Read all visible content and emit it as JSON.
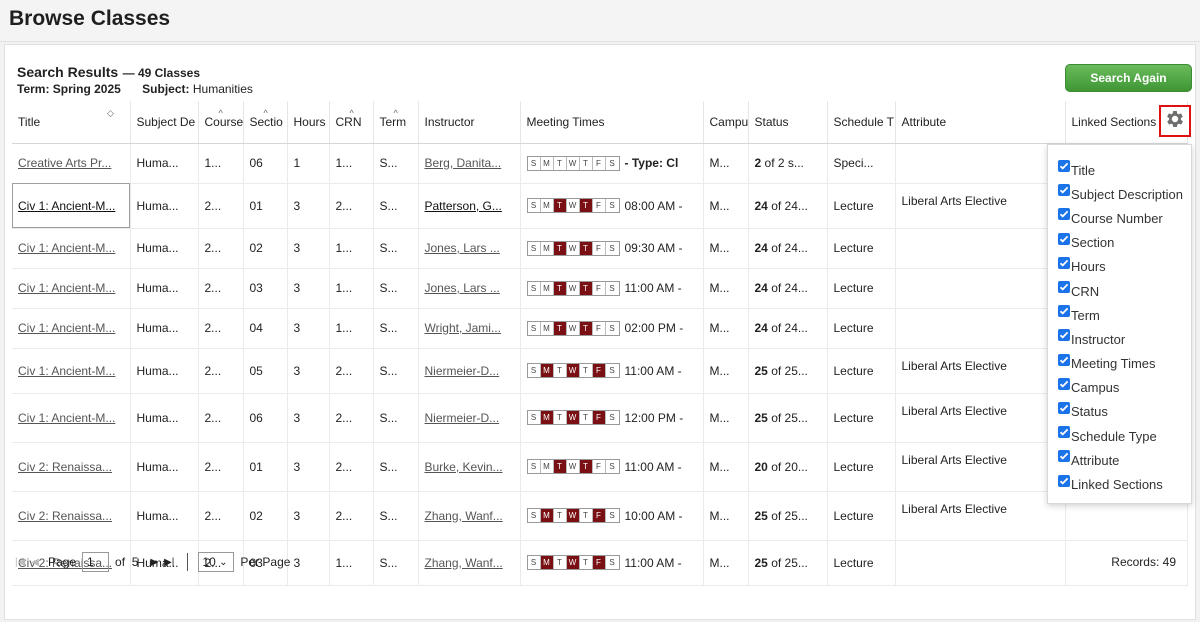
{
  "page": {
    "title": "Browse Classes"
  },
  "results": {
    "heading": "Search Results",
    "count": "— 49 Classes",
    "term_label": "Term:",
    "term_value": "Spring 2025",
    "subject_label": "Subject:",
    "subject_value": "Humanities",
    "search_again": "Search Again"
  },
  "columns": [
    "Title",
    "Subject Description",
    "Course Number",
    "Section",
    "Hours",
    "CRN",
    "Term",
    "Instructor",
    "Meeting Times",
    "Campus",
    "Status",
    "Schedule Type",
    "Attribute",
    "Linked Sections"
  ],
  "rows": [
    {
      "title": "Creative Arts Pr...",
      "subject": "Huma...",
      "course": "1...",
      "section": "06",
      "hours": "1",
      "crn": "1...",
      "term": "S...",
      "instructor": "Berg, Danita...",
      "days": [
        0,
        0,
        0,
        0,
        0,
        0,
        0
      ],
      "mt_text": "- Type: Cl",
      "mt_bold": true,
      "campus": "M...",
      "status_bold": "2",
      "status_rest": " of 2 s...",
      "sched": "Speci...",
      "attr": ""
    },
    {
      "title": "Civ 1: Ancient-M...",
      "subject": "Huma...",
      "course": "2...",
      "section": "01",
      "hours": "3",
      "crn": "2...",
      "term": "S...",
      "instructor": "Patterson, G...",
      "days": [
        0,
        0,
        1,
        0,
        1,
        0,
        0
      ],
      "mt_text": "08:00 AM -",
      "mt_bold": false,
      "campus": "M...",
      "status_bold": "24",
      "status_rest": " of 24...",
      "sched": "Lecture",
      "attr": "Liberal Arts Elective"
    },
    {
      "title": "Civ 1: Ancient-M...",
      "subject": "Huma...",
      "course": "2...",
      "section": "02",
      "hours": "3",
      "crn": "1...",
      "term": "S...",
      "instructor": "Jones, Lars ...",
      "days": [
        0,
        0,
        1,
        0,
        1,
        0,
        0
      ],
      "mt_text": "09:30 AM -",
      "mt_bold": false,
      "campus": "M...",
      "status_bold": "24",
      "status_rest": " of 24...",
      "sched": "Lecture",
      "attr": ""
    },
    {
      "title": "Civ 1: Ancient-M...",
      "subject": "Huma...",
      "course": "2...",
      "section": "03",
      "hours": "3",
      "crn": "1...",
      "term": "S...",
      "instructor": "Jones, Lars ...",
      "days": [
        0,
        0,
        1,
        0,
        1,
        0,
        0
      ],
      "mt_text": "11:00 AM -",
      "mt_bold": false,
      "campus": "M...",
      "status_bold": "24",
      "status_rest": " of 24...",
      "sched": "Lecture",
      "attr": ""
    },
    {
      "title": "Civ 1: Ancient-M...",
      "subject": "Huma...",
      "course": "2...",
      "section": "04",
      "hours": "3",
      "crn": "1...",
      "term": "S...",
      "instructor": "Wright, Jami...",
      "days": [
        0,
        0,
        1,
        0,
        1,
        0,
        0
      ],
      "mt_text": "02:00 PM -",
      "mt_bold": false,
      "campus": "M...",
      "status_bold": "24",
      "status_rest": " of 24...",
      "sched": "Lecture",
      "attr": ""
    },
    {
      "title": "Civ 1: Ancient-M...",
      "subject": "Huma...",
      "course": "2...",
      "section": "05",
      "hours": "3",
      "crn": "2...",
      "term": "S...",
      "instructor": "Niermeier-D...",
      "days": [
        0,
        1,
        0,
        1,
        0,
        1,
        0
      ],
      "mt_text": "11:00 AM -",
      "mt_bold": false,
      "campus": "M...",
      "status_bold": "25",
      "status_rest": " of 25...",
      "sched": "Lecture",
      "attr": "Liberal Arts Elective"
    },
    {
      "title": "Civ 1: Ancient-M...",
      "subject": "Huma...",
      "course": "2...",
      "section": "06",
      "hours": "3",
      "crn": "2...",
      "term": "S...",
      "instructor": "Niermeier-D...",
      "days": [
        0,
        1,
        0,
        1,
        0,
        1,
        0
      ],
      "mt_text": "12:00 PM -",
      "mt_bold": false,
      "campus": "M...",
      "status_bold": "25",
      "status_rest": " of 25...",
      "sched": "Lecture",
      "attr": "Liberal Arts Elective"
    },
    {
      "title": "Civ 2: Renaissa...",
      "subject": "Huma...",
      "course": "2...",
      "section": "01",
      "hours": "3",
      "crn": "2...",
      "term": "S...",
      "instructor": "Burke, Kevin...",
      "days": [
        0,
        0,
        1,
        0,
        1,
        0,
        0
      ],
      "mt_text": "11:00 AM -",
      "mt_bold": false,
      "campus": "M...",
      "status_bold": "20",
      "status_rest": " of 20...",
      "sched": "Lecture",
      "attr": "Liberal Arts Elective"
    },
    {
      "title": "Civ 2: Renaissa...",
      "subject": "Huma...",
      "course": "2...",
      "section": "02",
      "hours": "3",
      "crn": "2...",
      "term": "S...",
      "instructor": "Zhang, Wanf...",
      "days": [
        0,
        1,
        0,
        1,
        0,
        1,
        0
      ],
      "mt_text": "10:00 AM -",
      "mt_bold": false,
      "campus": "M...",
      "status_bold": "25",
      "status_rest": " of 25...",
      "sched": "Lecture",
      "attr": "Liberal Arts Elective"
    },
    {
      "title": "Civ 2: Renaissa...",
      "subject": "Huma...",
      "course": "2...",
      "section": "03",
      "hours": "3",
      "crn": "1...",
      "term": "S...",
      "instructor": "Zhang, Wanf...",
      "days": [
        0,
        1,
        0,
        1,
        0,
        1,
        0
      ],
      "mt_text": "11:00 AM -",
      "mt_bold": false,
      "campus": "M...",
      "status_bold": "25",
      "status_rest": " of 25...",
      "sched": "Lecture",
      "attr": ""
    }
  ],
  "day_letters": [
    "S",
    "M",
    "T",
    "W",
    "T",
    "F",
    "S"
  ],
  "header_labels": [
    "Title",
    "Subject De",
    "Course",
    "Sectio",
    "Hours",
    "CRN",
    "Term",
    "Instructor",
    "Meeting Times",
    "Campu",
    "Status",
    "Schedule T",
    "Attribute",
    "Linked Sections"
  ],
  "column_menu": [
    "Title",
    "Subject Description",
    "Course Number",
    "Section",
    "Hours",
    "CRN",
    "Term",
    "Instructor",
    "Meeting Times",
    "Campus",
    "Status",
    "Schedule Type",
    "Attribute",
    "Linked Sections"
  ],
  "pager": {
    "page_label": "Page",
    "page_value": "1",
    "of_label": "of",
    "total_pages": "5",
    "per_page_value": "10",
    "per_page_label": "Per Page",
    "records": "Records: 49"
  },
  "colors": {
    "day_on": "#7a1014",
    "search_again": "#4aa33f",
    "highlight": "#e01010"
  }
}
